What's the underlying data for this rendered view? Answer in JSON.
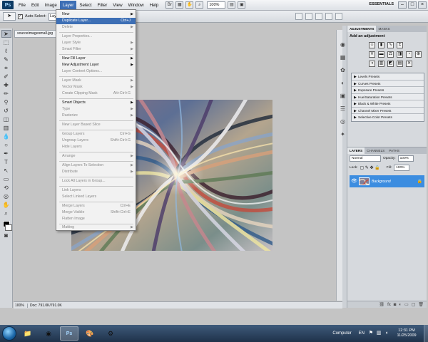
{
  "app": {
    "logo": "Ps",
    "menus": [
      "File",
      "Edit",
      "Image",
      "Layer",
      "Select",
      "Filter",
      "View",
      "Window",
      "Help"
    ],
    "active_menu": "Layer",
    "zoom_select": "100%",
    "workspace": "ESSENTIALS"
  },
  "options_bar": {
    "auto_select_label": "Auto-Select:",
    "auto_select_value": "Lay"
  },
  "document": {
    "tab_label": "sourceimagesmall.jpg",
    "status_zoom": "100%",
    "status_doc": "Doc: 791.0K/791.0K"
  },
  "layer_menu": {
    "items": [
      {
        "label": "New",
        "submenu": true
      },
      {
        "label": "Duplicate Layer...",
        "highlighted": true
      },
      {
        "label": "Delete",
        "submenu": true
      },
      {
        "label": "Layer Properties...",
        "disabled": true
      },
      {
        "label": "Layer Style",
        "submenu": true
      },
      {
        "label": "Smart Filter",
        "disabled": true,
        "submenu": true
      },
      {
        "label": "New Fill Layer",
        "submenu": true
      },
      {
        "label": "New Adjustment Layer",
        "submenu": true
      },
      {
        "label": "Layer Content Options...",
        "disabled": true
      },
      {
        "label": "Layer Mask",
        "disabled": true,
        "submenu": true
      },
      {
        "label": "Vector Mask",
        "disabled": true,
        "submenu": true
      },
      {
        "label": "Create Clipping Mask",
        "shortcut": "Alt+Ctrl+G",
        "disabled": true
      },
      {
        "label": "Smart Objects",
        "submenu": true
      },
      {
        "label": "Type",
        "disabled": true,
        "submenu": true
      },
      {
        "label": "Rasterize",
        "disabled": true,
        "submenu": true
      },
      {
        "label": "New Layer Based Slice",
        "disabled": true
      },
      {
        "label": "Group Layers",
        "shortcut": "Ctrl+G",
        "disabled": true
      },
      {
        "label": "Ungroup Layers",
        "shortcut": "Shift+Ctrl+G",
        "disabled": true
      },
      {
        "label": "Hide Layers",
        "disabled": true
      },
      {
        "label": "Arrange",
        "disabled": true,
        "submenu": true
      },
      {
        "label": "Align Layers To Selection",
        "disabled": true,
        "submenu": true
      },
      {
        "label": "Distribute",
        "disabled": true,
        "submenu": true
      },
      {
        "label": "Lock All Layers in Group...",
        "disabled": true
      },
      {
        "label": "Link Layers",
        "disabled": true
      },
      {
        "label": "Select Linked Layers",
        "disabled": true
      },
      {
        "label": "Merge Layers",
        "shortcut": "Ctrl+E",
        "disabled": true
      },
      {
        "label": "Merge Visible",
        "shortcut": "Shift+Ctrl+E",
        "disabled": true
      },
      {
        "label": "Flatten Image",
        "disabled": true
      },
      {
        "label": "Matting",
        "disabled": true,
        "submenu": true
      }
    ],
    "new_shortcut": "",
    "duplicate_shortcut": "Ctrl+J"
  },
  "adjustments_panel": {
    "tabs": [
      "ADJUSTMENTS",
      "MASKS"
    ],
    "title": "Add an adjustment",
    "presets": [
      "Levels Presets",
      "Curves Presets",
      "Exposure Presets",
      "Hue/Saturation Presets",
      "Black & White Presets",
      "Channel Mixer Presets",
      "Selective Color Presets"
    ]
  },
  "layers_panel": {
    "tabs": [
      "LAYERS",
      "CHANNELS",
      "PATHS"
    ],
    "blend_mode": "Normal",
    "opacity_label": "Opacity:",
    "opacity_value": "100%",
    "lock_label": "Lock:",
    "fill_label": "Fill:",
    "fill_value": "100%",
    "layers": [
      {
        "name": "Background",
        "selected": true,
        "locked": true
      }
    ]
  },
  "taskbar": {
    "tray_label": "Computer",
    "language": "EN",
    "time": "12:31 PM",
    "date": "11/25/2009"
  },
  "colors": {
    "menu_highlight": "#3d6fb5",
    "layer_selected": "#3c8de0"
  }
}
